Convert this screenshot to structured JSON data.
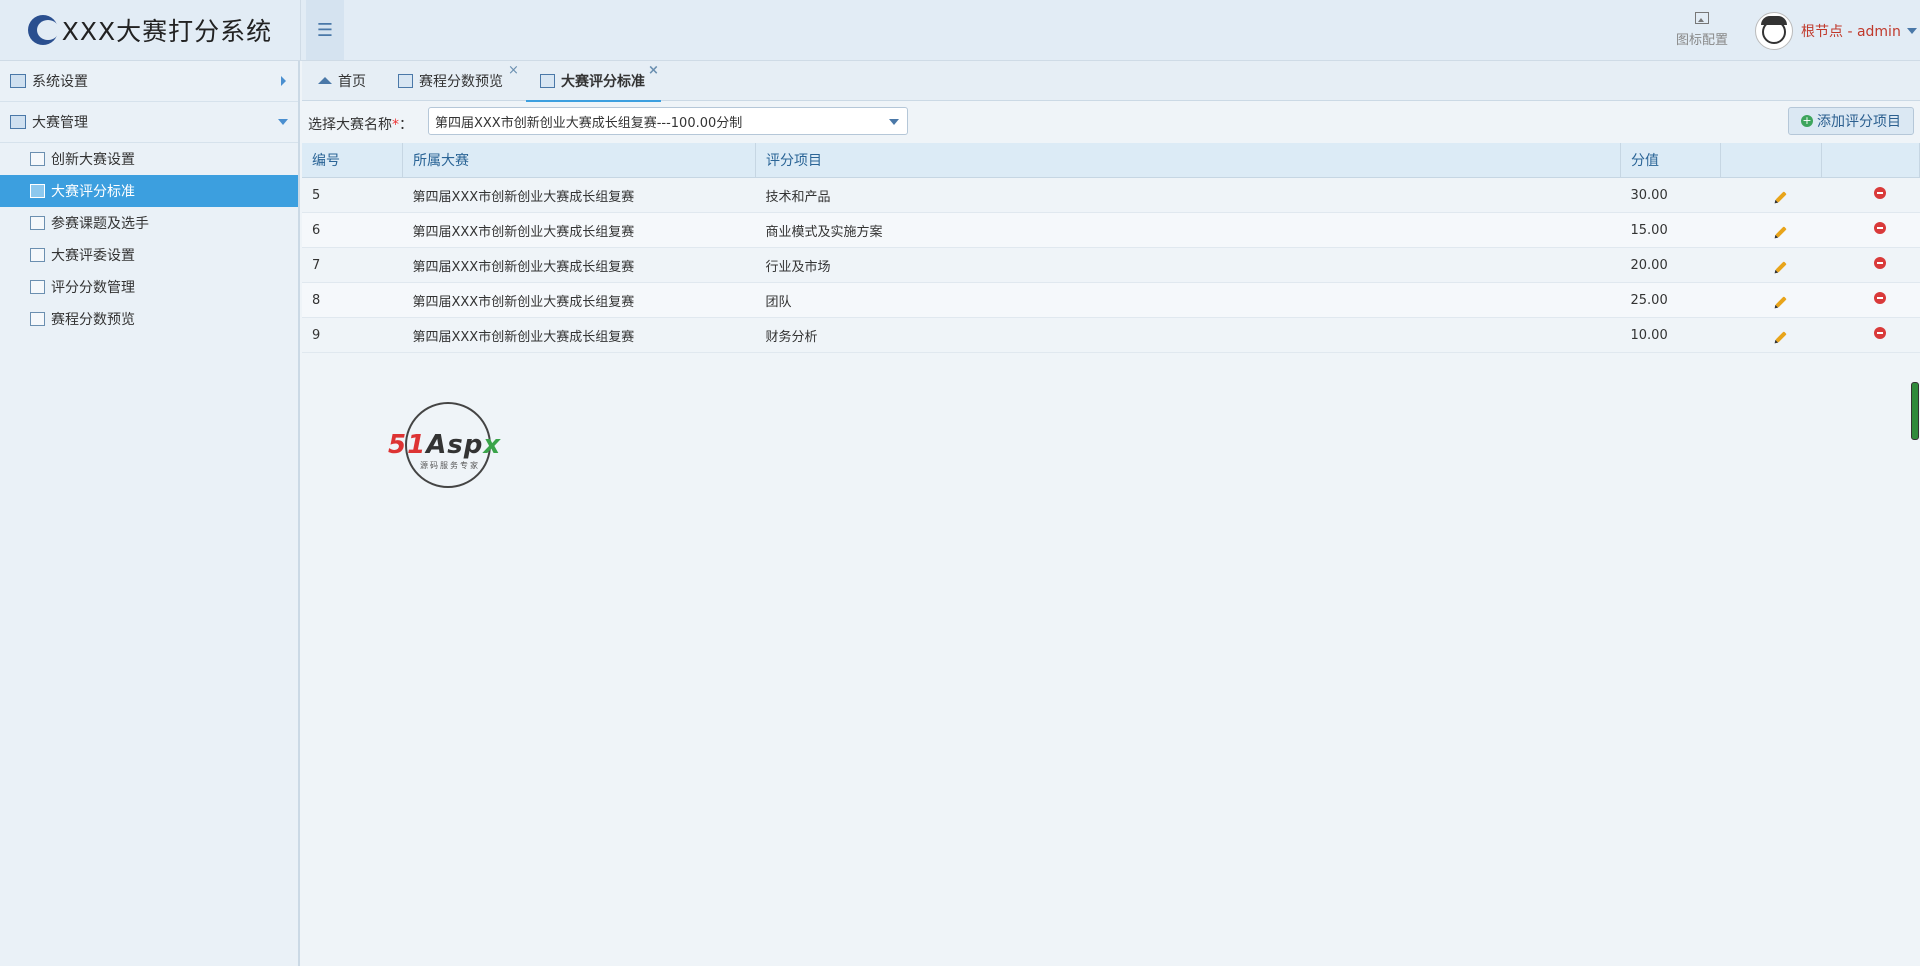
{
  "app": {
    "title": "XXX大赛打分系统"
  },
  "header": {
    "icon_config_label": "图标配置",
    "user_label": "根节点 - admin"
  },
  "sidebar": {
    "groups": [
      {
        "label": "系统设置",
        "expanded": false
      },
      {
        "label": "大赛管理",
        "expanded": true
      }
    ],
    "items": [
      {
        "label": "创新大赛设置"
      },
      {
        "label": "大赛评分标准",
        "active": true
      },
      {
        "label": "参赛课题及选手"
      },
      {
        "label": "大赛评委设置"
      },
      {
        "label": "评分分数管理"
      },
      {
        "label": "赛程分数预览"
      }
    ]
  },
  "tabs": [
    {
      "label": "首页"
    },
    {
      "label": "赛程分数预览"
    },
    {
      "label": "大赛评分标准",
      "active": true
    }
  ],
  "toolbar": {
    "select_label": "选择大赛名称",
    "required_mark": "*",
    "label_suffix": "：",
    "select_value": "第四届XXX市创新创业大赛成长组复赛---100.00分制",
    "add_button_label": "添加评分项目"
  },
  "table": {
    "headers": [
      "编号",
      "所属大赛",
      "评分项目",
      "分值",
      "",
      ""
    ],
    "rows": [
      {
        "id": "5",
        "contest": "第四届XXX市创新创业大赛成长组复赛",
        "item": "技术和产品",
        "score": "30.00"
      },
      {
        "id": "6",
        "contest": "第四届XXX市创新创业大赛成长组复赛",
        "item": "商业模式及实施方案",
        "score": "15.00"
      },
      {
        "id": "7",
        "contest": "第四届XXX市创新创业大赛成长组复赛",
        "item": "行业及市场",
        "score": "20.00"
      },
      {
        "id": "8",
        "contest": "第四届XXX市创新创业大赛成长组复赛",
        "item": "团队",
        "score": "25.00"
      },
      {
        "id": "9",
        "contest": "第四届XXX市创新创业大赛成长组复赛",
        "item": "财务分析",
        "score": "10.00"
      }
    ]
  },
  "watermark": {
    "brand": "51Aspx",
    "tagline": "源码服务专家"
  },
  "colors": {
    "accent": "#3c9fdf",
    "header_bg": "#e2ecf5",
    "user_red": "#c0392b"
  }
}
